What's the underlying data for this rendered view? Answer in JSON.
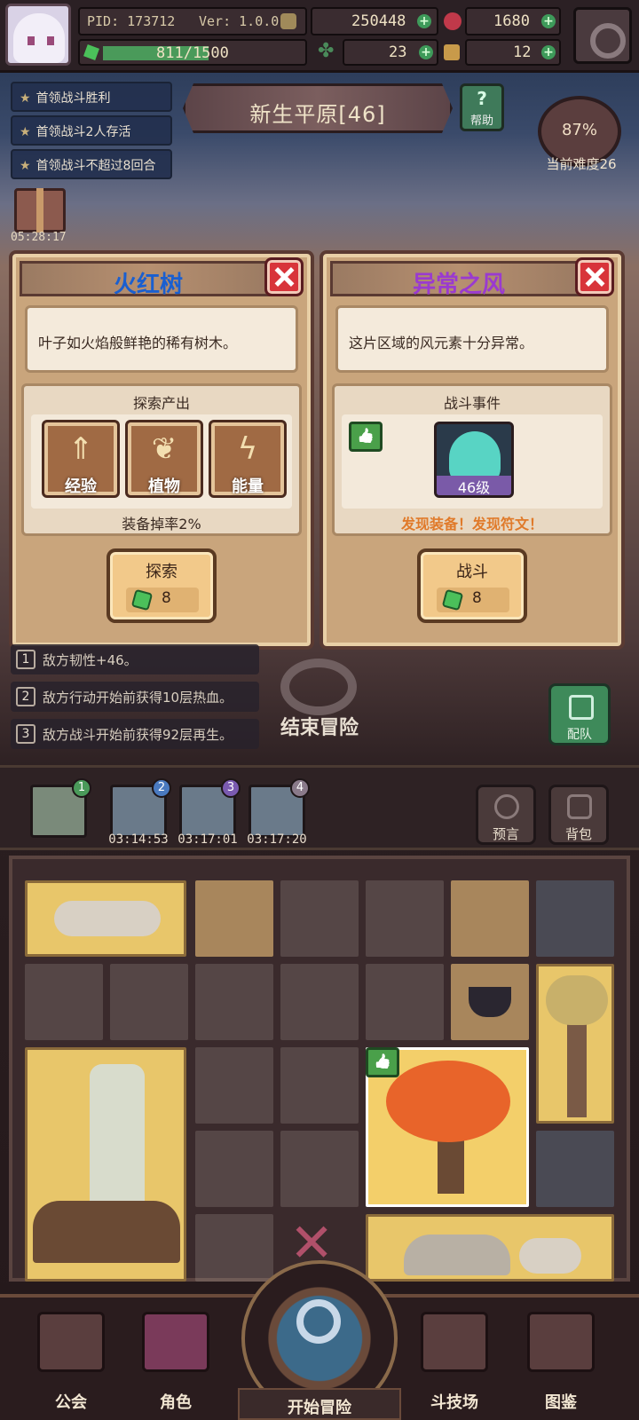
{
  "hud": {
    "pid": "PID: 173712",
    "version": "Ver: 1.0.0.0",
    "gold": "250448",
    "gems": "1680",
    "energy": "811/1500",
    "energy_fraction": 0.54,
    "clover": "23",
    "keys": "12"
  },
  "quests": [
    "首领战斗胜利",
    "首领战斗2人存活",
    "首领战斗不超过8回合"
  ],
  "location": {
    "name": "新生平原[46]",
    "help": "帮助"
  },
  "difficulty": {
    "percent": "87%",
    "label": "当前难度26"
  },
  "chest_timer": "05:28:17",
  "card_left": {
    "title": "火红树",
    "title_color": "#1a5fd0",
    "description": "叶子如火焰般鲜艳的稀有树木。",
    "panel_title": "探索产出",
    "resources": [
      {
        "label": "经验",
        "icon": "experience-icon"
      },
      {
        "label": "植物",
        "icon": "leaf-icon"
      },
      {
        "label": "能量",
        "icon": "lightning-icon"
      }
    ],
    "drop_rate": "装备掉率2%",
    "action": "探索",
    "cost": "8"
  },
  "card_right": {
    "title": "异常之风",
    "title_color": "#9a3ad0",
    "description": "这片区域的风元素十分异常。",
    "panel_title": "战斗事件",
    "enemy_level": "46级",
    "found": "发现装备！发现符文！",
    "action": "战斗",
    "cost": "8"
  },
  "effects": [
    {
      "num": "1",
      "text": "敌方韧性+46。"
    },
    {
      "num": "2",
      "text": "敌方行动开始前获得10层热血。"
    },
    {
      "num": "3",
      "text": "敌方战斗开始前获得92层再生。"
    }
  ],
  "end_adventure": "结束冒险",
  "team": "配队",
  "squads": [
    {
      "badge": "1",
      "time": ""
    },
    {
      "badge": "2",
      "time": "03:14:53"
    },
    {
      "badge": "3",
      "time": "03:17:01"
    },
    {
      "badge": "4",
      "time": "03:17:20"
    }
  ],
  "side_buttons": {
    "prophecy": "预言",
    "backpack": "背包"
  },
  "nav": {
    "guild": "公会",
    "character": "角色",
    "start": "开始冒险",
    "arena": "斗技场",
    "codex": "图鉴"
  }
}
